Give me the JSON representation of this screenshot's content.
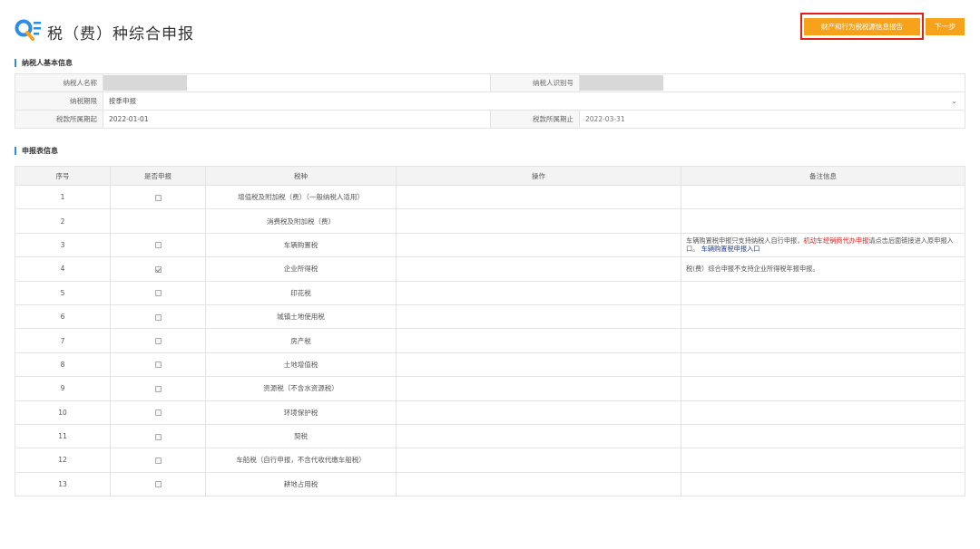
{
  "header": {
    "title": "税（费）种综合申报",
    "report_button": "财产和行为税税源信息报告",
    "next_button": "下一步",
    "accent_color": "#f7a21b",
    "highlight_color": "#e0201a"
  },
  "taxpayer_section": {
    "title": "纳税人基本信息",
    "name_label": "纳税人名称",
    "name_value": "",
    "id_label": "纳税人识别号",
    "id_value": "",
    "period_label": "纳税期限",
    "period_value": "按季申报",
    "start_label": "税款所属期起",
    "start_value": "2022-01-01",
    "end_label": "税款所属期止",
    "end_value": "2022-03-31"
  },
  "declaration_section": {
    "title": "申报表信息",
    "headers": [
      "序号",
      "是否申报",
      "税种",
      "操作",
      "备注信息"
    ],
    "rows": [
      {
        "no": "1",
        "checked": false,
        "has_checkbox": true,
        "tax": "增值税及附加税（费）（一般纳税人适用）"
      },
      {
        "no": "2",
        "checked": false,
        "has_checkbox": false,
        "tax": "消费税及附加税（费）"
      },
      {
        "no": "3",
        "checked": false,
        "has_checkbox": true,
        "tax": "车辆购置税",
        "note_part1": "车辆购置税申报只支持纳税人自行申报，",
        "note_red": "机动车经销商代办申报",
        "note_part2": "请点击后面链接进入原申报入口。",
        "note_link": "车辆购置税申报入口"
      },
      {
        "no": "4",
        "checked": true,
        "has_checkbox": true,
        "tax": "企业所得税",
        "note": "税(费）综合申报不支持企业所得税年报申报。"
      },
      {
        "no": "5",
        "checked": false,
        "has_checkbox": true,
        "tax": "印花税"
      },
      {
        "no": "6",
        "checked": false,
        "has_checkbox": true,
        "tax": "城镇土地使用税"
      },
      {
        "no": "7",
        "checked": false,
        "has_checkbox": true,
        "tax": "房产税"
      },
      {
        "no": "8",
        "checked": false,
        "has_checkbox": true,
        "tax": "土地增值税"
      },
      {
        "no": "9",
        "checked": false,
        "has_checkbox": true,
        "tax": "资源税（不含水资源税）"
      },
      {
        "no": "10",
        "checked": false,
        "has_checkbox": true,
        "tax": "环境保护税"
      },
      {
        "no": "11",
        "checked": false,
        "has_checkbox": true,
        "tax": "契税"
      },
      {
        "no": "12",
        "checked": false,
        "has_checkbox": true,
        "tax": "车船税（自行申报，不含代收代缴车船税）"
      },
      {
        "no": "13",
        "checked": false,
        "has_checkbox": true,
        "tax": "耕地占用税"
      }
    ]
  }
}
